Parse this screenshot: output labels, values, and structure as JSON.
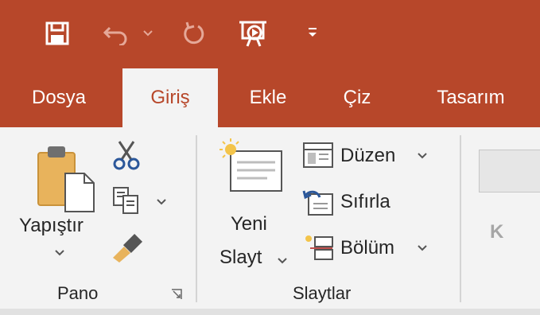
{
  "qat": {
    "save": "save-icon",
    "undo": "undo-icon",
    "redo": "redo-icon",
    "slideshow": "start-slideshow-icon",
    "customize": "customize-qat-icon"
  },
  "tabs": [
    {
      "label": "Dosya"
    },
    {
      "label": "Giriş"
    },
    {
      "label": "Ekle"
    },
    {
      "label": "Çiz"
    },
    {
      "label": "Tasarım"
    }
  ],
  "clipboard": {
    "paste_label": "Yapıştır",
    "group_label": "Pano"
  },
  "slides": {
    "new_slide_line1": "Yeni",
    "new_slide_line2": "Slayt",
    "layout_label": "Düzen",
    "reset_label": "Sıfırla",
    "section_label": "Bölüm",
    "group_label": "Slaytlar"
  },
  "font": {
    "bold_label": "K"
  },
  "colors": {
    "accent": "#b7472a",
    "ribbon_bg": "#f3f3f3"
  }
}
